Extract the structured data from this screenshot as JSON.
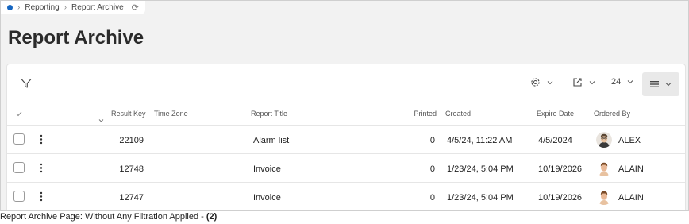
{
  "breadcrumb": {
    "items": [
      "Reporting",
      "Report Archive"
    ]
  },
  "page": {
    "title": "Report Archive"
  },
  "toolbar": {
    "page_size": "24"
  },
  "table": {
    "columns": {
      "result_key": "Result Key",
      "time_zone": "Time Zone",
      "report_title": "Report Title",
      "printed": "Printed",
      "created": "Created",
      "expire_date": "Expire Date",
      "ordered_by": "Ordered By"
    },
    "rows": [
      {
        "result_key": "22109",
        "time_zone": "",
        "report_title": "Alarm list",
        "printed": "0",
        "created": "4/5/24, 11:22 AM",
        "expire_date": "4/5/2024",
        "ordered_by": "ALEX"
      },
      {
        "result_key": "12748",
        "time_zone": "",
        "report_title": "Invoice",
        "printed": "0",
        "created": "1/23/24, 5:04 PM",
        "expire_date": "10/19/2026",
        "ordered_by": "ALAIN"
      },
      {
        "result_key": "12747",
        "time_zone": "",
        "report_title": "Invoice",
        "printed": "0",
        "created": "1/23/24, 5:04 PM",
        "expire_date": "10/19/2026",
        "ordered_by": "ALAIN"
      }
    ]
  },
  "caption": {
    "text": "Report Archive Page: Without Any Filtration Applied - ",
    "bold": "(2)"
  },
  "icons": [
    "home-dot-icon",
    "chevron-right-icon",
    "refresh-icon",
    "filter-icon",
    "settings-gear-icon",
    "chevron-down-icon",
    "export-icon",
    "list-view-icon",
    "check-icon",
    "sort-chevron-icon",
    "kebab-menu-icon",
    "avatar"
  ],
  "colors": {
    "accent": "#1565c0",
    "page_bg": "#f2f2f2",
    "panel_bg": "#ffffff"
  }
}
